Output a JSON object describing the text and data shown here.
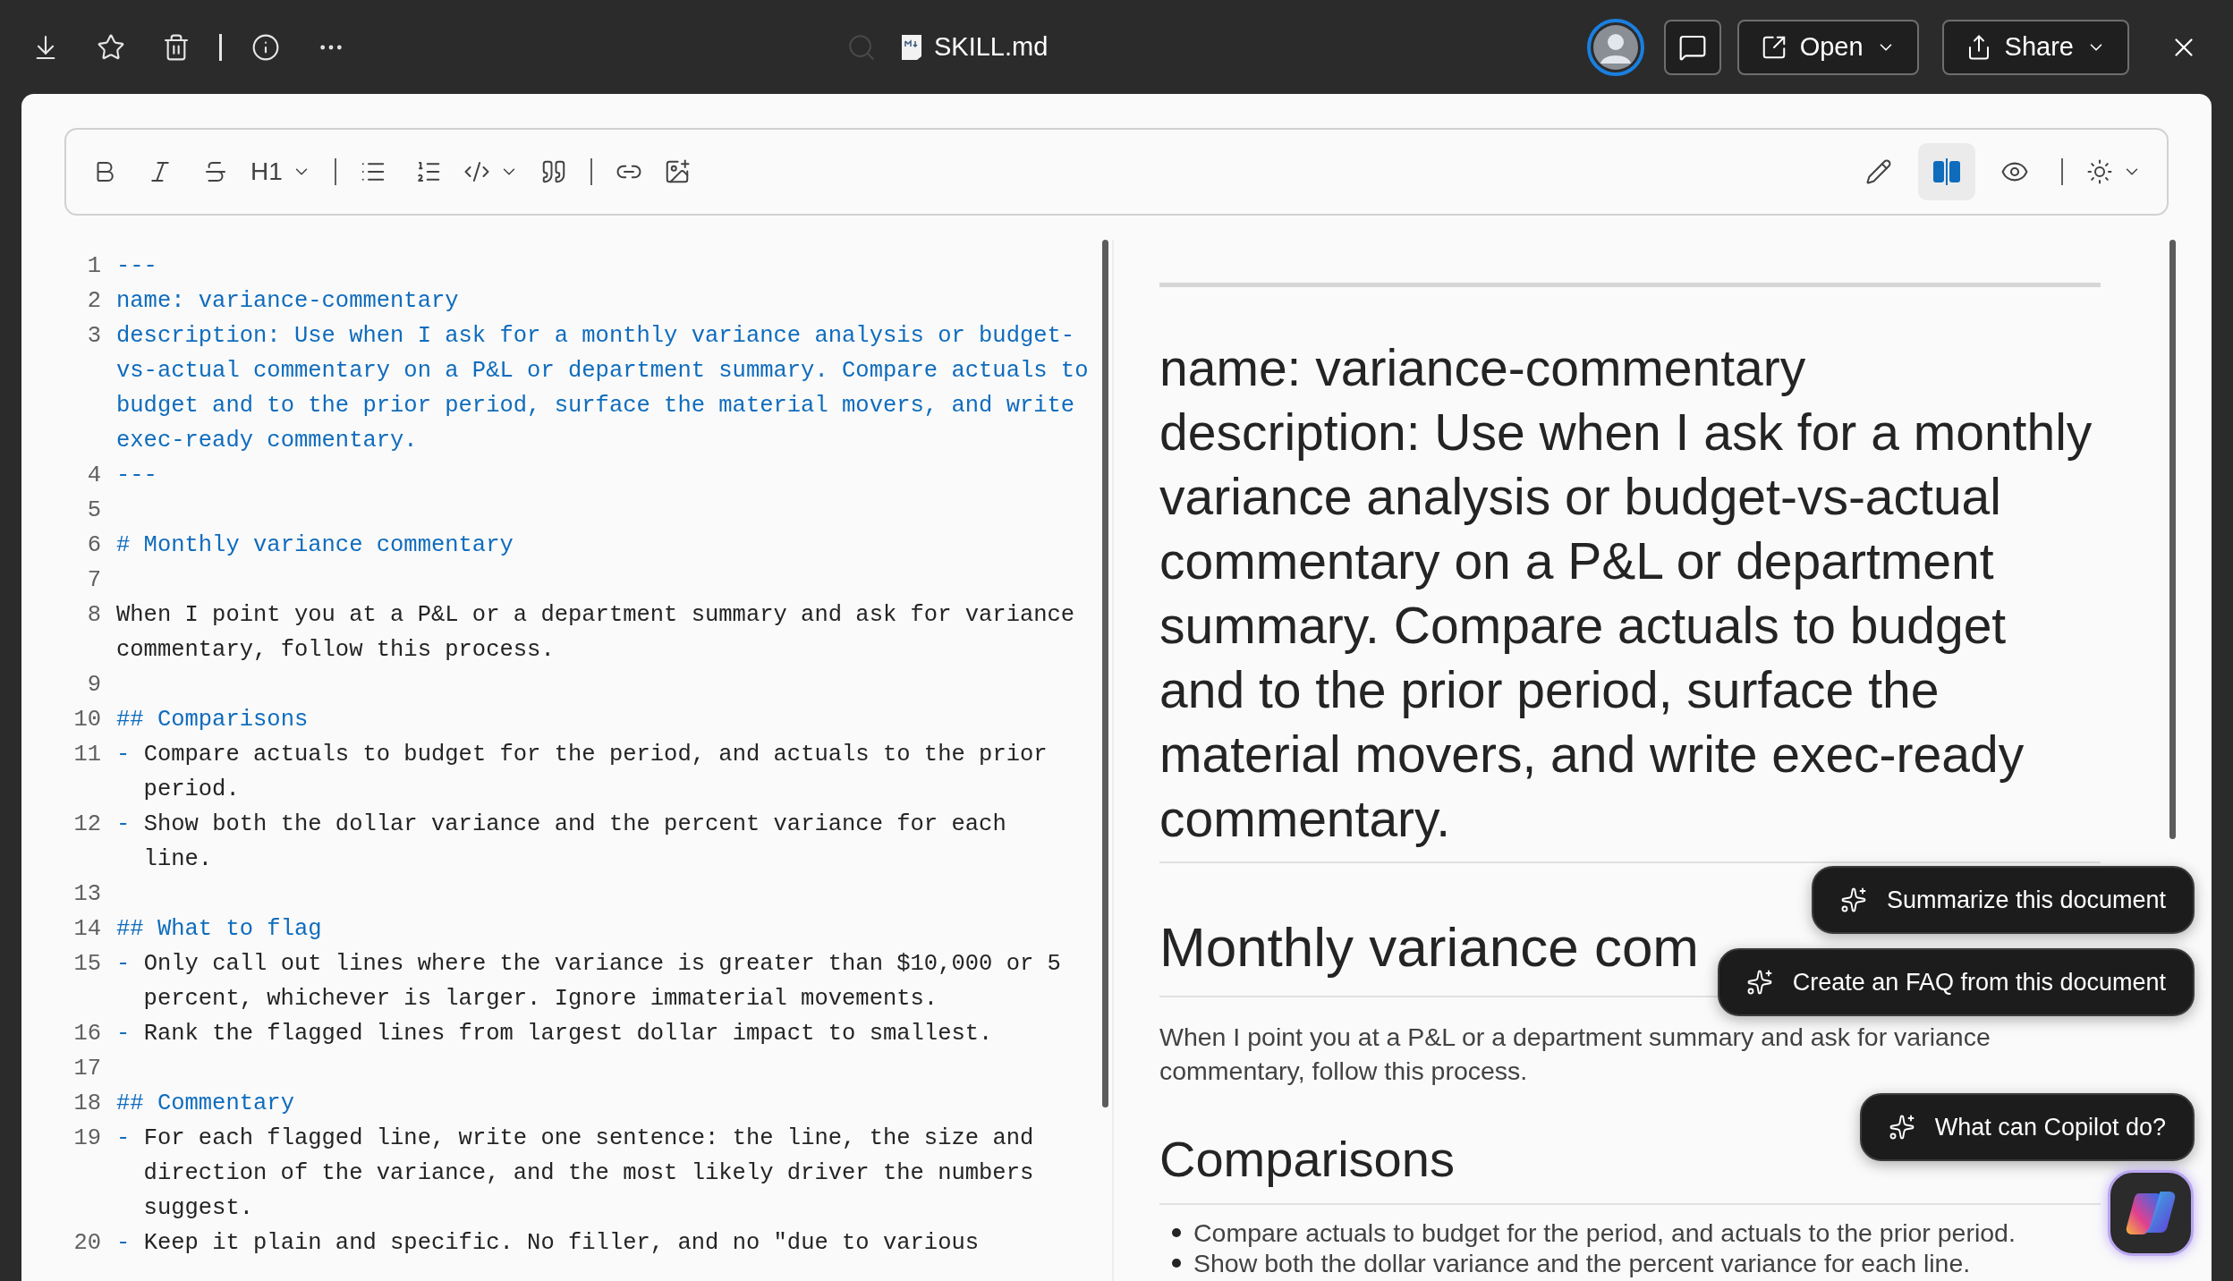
{
  "top_bar": {
    "file_name": "SKILL.md",
    "buttons": [
      {
        "kind": "open",
        "label": "Open"
      },
      {
        "kind": "share",
        "label": "Share"
      }
    ]
  },
  "toolbar": {
    "heading_label": "H1",
    "view_modes": [
      {
        "kind": "edit",
        "selected": false
      },
      {
        "kind": "split",
        "selected": true
      },
      {
        "kind": "preview",
        "selected": false
      }
    ]
  },
  "editor": {
    "lines": [
      {
        "number": "1",
        "kind": "meta",
        "text": "---"
      },
      {
        "number": "2",
        "kind": "meta",
        "text": "name: variance-commentary"
      },
      {
        "number": "3",
        "kind": "meta",
        "text": "description: Use when I ask for a monthly variance analysis or budget-vs-actual commentary on a P&L or department summary. Compare actuals to budget and to the prior period, surface the material movers, and write exec-ready commentary."
      },
      {
        "number": "4",
        "kind": "meta",
        "text": "---"
      },
      {
        "number": "5",
        "kind": "blank"
      },
      {
        "number": "6",
        "kind": "heading",
        "text": "# Monthly variance commentary"
      },
      {
        "number": "7",
        "kind": "blank"
      },
      {
        "number": "8",
        "kind": "plain",
        "text": "When I point you at a P&L or a department summary and ask for variance commentary, follow this process."
      },
      {
        "number": "9",
        "kind": "blank"
      },
      {
        "number": "10",
        "kind": "heading",
        "text": "## Comparisons"
      },
      {
        "number": "11",
        "kind": "bullet",
        "marker": "-",
        "text": "Compare actuals to budget for the period, and actuals to the prior period."
      },
      {
        "number": "12",
        "kind": "bullet",
        "marker": "-",
        "text": "Show both the dollar variance and the percent variance for each line."
      },
      {
        "number": "13",
        "kind": "blank"
      },
      {
        "number": "14",
        "kind": "heading",
        "text": "## What to flag"
      },
      {
        "number": "15",
        "kind": "bullet",
        "marker": "-",
        "text": "Only call out lines where the variance is greater than $10,000 or 5 percent, whichever is larger. Ignore immaterial movements."
      },
      {
        "number": "16",
        "kind": "bullet",
        "marker": "-",
        "text": "Rank the flagged lines from largest dollar impact to smallest."
      },
      {
        "number": "17",
        "kind": "blank"
      },
      {
        "number": "18",
        "kind": "heading",
        "text": "## Commentary"
      },
      {
        "number": "19",
        "kind": "bullet",
        "marker": "-",
        "text": "For each flagged line, write one sentence: the line, the size and direction of the variance, and the most likely driver the numbers suggest."
      },
      {
        "number": "20",
        "kind": "bullet",
        "marker": "-",
        "text": "Keep it plain and specific. No filler, and no \"due to various"
      }
    ]
  },
  "preview": {
    "blocks": [
      {
        "kind": "rule"
      },
      {
        "kind": "title",
        "lines": [
          "name: variance-commentary",
          "description: Use when I ask for a monthly variance analysis or budget-vs-actual commentary on a P&L or department summary. Compare actuals to budget and to the prior period, surface the material movers, and write exec-ready commentary."
        ]
      },
      {
        "kind": "h1",
        "text": "Monthly variance com"
      },
      {
        "kind": "paragraph",
        "text": "When I point you at a P&L or a department summary and ask for variance commentary, follow this process."
      },
      {
        "kind": "h2",
        "text": "Comparisons"
      },
      {
        "kind": "list",
        "items": [
          "Compare actuals to budget for the period, and actuals to the prior period.",
          "Show both the dollar variance and the percent variance for each line."
        ]
      }
    ]
  },
  "suggestions": [
    "Summarize this document",
    "Create an FAQ from this document",
    "What can Copilot do?"
  ]
}
